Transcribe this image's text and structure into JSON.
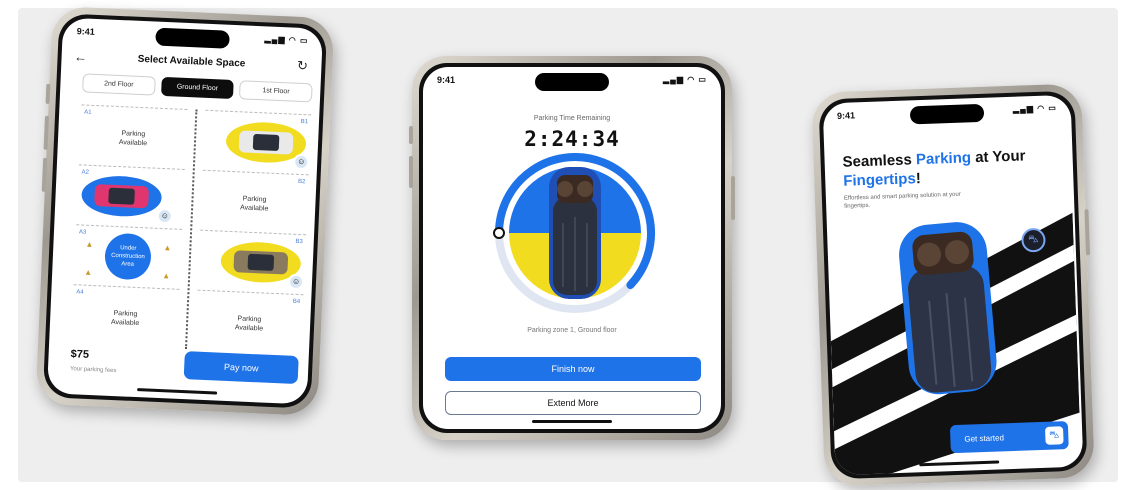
{
  "phone1": {
    "time": "9:41",
    "title": "Select Available Space",
    "back_icon": "arrow-left-icon",
    "refresh_icon": "refresh-icon",
    "floor_tabs": [
      "2nd Floor",
      "Ground Floor",
      "1st Floor"
    ],
    "active_floor": "Ground Floor",
    "slots_left": [
      {
        "id": "A1",
        "status": "Parking Available"
      },
      {
        "id": "A2",
        "car": "pink car"
      },
      {
        "id": "A3",
        "status": "Under Construction Area"
      },
      {
        "id": "A4",
        "status": "Parking Available"
      }
    ],
    "slots_right": [
      {
        "id": "B1",
        "car": "yellow car"
      },
      {
        "id": "B2",
        "status": "Parking Available"
      },
      {
        "id": "B3",
        "car": "yellow car"
      },
      {
        "id": "B4",
        "status": "Parking Available"
      }
    ],
    "price": "$75",
    "price_caption": "Your parking fees",
    "pay_button": "Pay now"
  },
  "phone2": {
    "time": "9:41",
    "timer_label": "Parking Time Remaining",
    "timer": "2:24:34",
    "progress_fraction": 0.62,
    "zone": "Parking zone 1, Ground floor",
    "finish_button": "Finish now",
    "extend_button": "Extend More"
  },
  "phone3": {
    "time": "9:41",
    "headline_part1": "Seamless ",
    "headline_accent1": "Parking",
    "headline_part2": " at Your ",
    "headline_accent2": "Fingertips",
    "headline_part3": "!",
    "subtext": "Effortless and smart parking solution at your fingertips.",
    "get_started_button": "Get started",
    "get_started_icon": "car-icon"
  },
  "colors": {
    "accent": "#1f73e8",
    "yellow": "#f2dc1f",
    "dark": "#111111"
  }
}
